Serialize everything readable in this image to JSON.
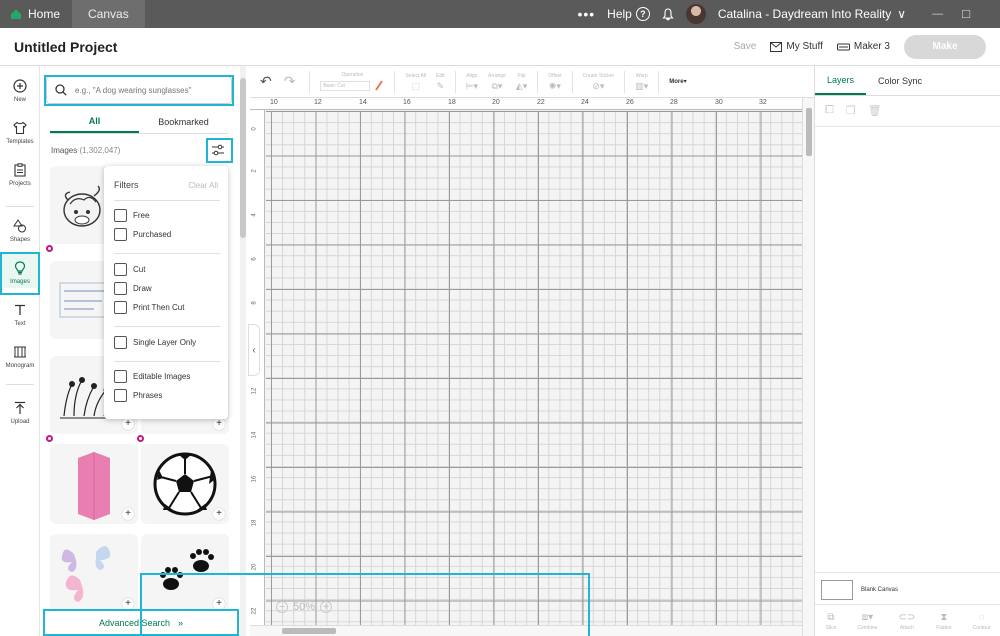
{
  "titlebar": {
    "home_label": "Home",
    "canvas_tab_label": "Canvas",
    "more_dots": "•••",
    "help_label": "Help",
    "help_symbol": "?",
    "user_name": "Catalina - Daydream Into Reality",
    "chevron": "∨",
    "minimize": "—",
    "maximize": "☐"
  },
  "header": {
    "title": "Untitled Project",
    "save_label": "Save",
    "my_stuff_label": "My Stuff",
    "machine_label": "Maker 3",
    "make_label": "Make"
  },
  "rail": {
    "items": [
      {
        "label": "New",
        "icon": "plus-circle-icon"
      },
      {
        "label": "Templates",
        "icon": "shirt-icon"
      },
      {
        "label": "Projects",
        "icon": "clipboard-icon"
      },
      {
        "label": "Shapes",
        "icon": "shapes-icon"
      },
      {
        "label": "Images",
        "icon": "lightbulb-icon",
        "active": true
      },
      {
        "label": "Text",
        "icon": "text-t-icon"
      },
      {
        "label": "Monogram",
        "icon": "monogram-icon"
      },
      {
        "label": "Upload",
        "icon": "upload-icon"
      }
    ]
  },
  "images_panel": {
    "search_placeholder": "e.g., \"A dog wearing sunglasses\"",
    "tabs": [
      "All",
      "Bookmarked"
    ],
    "count_label": "Images",
    "count_value": "(1,302,047)",
    "advanced_search_label": "Advanced Search",
    "advanced_search_arrow": "»",
    "plus": "+"
  },
  "filters": {
    "title": "Filters",
    "clear_all": "Clear All",
    "groups": [
      [
        "Free",
        "Purchased"
      ],
      [
        "Cut",
        "Draw",
        "Print Then Cut"
      ],
      [
        "Single Layer Only"
      ],
      [
        "Editable Images",
        "Phrases"
      ]
    ]
  },
  "toolbar": {
    "undo": "↶",
    "redo": "↷",
    "operation_label": "Operation",
    "operation_value": "Basic Cut",
    "select_all_label": "Select All",
    "edit_label": "Edit",
    "align_label": "Align",
    "arrange_label": "Arrange",
    "flip_label": "Flip",
    "offset_label": "Offset",
    "create_sticker_label": "Create Sticker",
    "warp_label": "Warp",
    "more_label": "More▾"
  },
  "canvas": {
    "ruler_top": [
      "10",
      "12",
      "14",
      "16",
      "18",
      "20",
      "22",
      "24",
      "26",
      "28",
      "30",
      "32"
    ],
    "ruler_left": [
      "0",
      "2",
      "4",
      "6",
      "8",
      "10",
      "12",
      "14",
      "16",
      "18",
      "20",
      "22"
    ],
    "zoom_minus": "−",
    "zoom_value": "50%",
    "zoom_plus": "+",
    "collapse_arrow": "‹"
  },
  "right_panel": {
    "tabs": [
      "Layers",
      "Color Sync"
    ],
    "blank_canvas_label": "Blank Canvas",
    "bottom_actions": [
      "Slice",
      "Combine",
      "Attach",
      "Flatten",
      "Contour"
    ]
  },
  "colors": {
    "accent_green": "#007a50",
    "highlight": "#1fb6d6",
    "badge_pink": "#c2187d"
  }
}
